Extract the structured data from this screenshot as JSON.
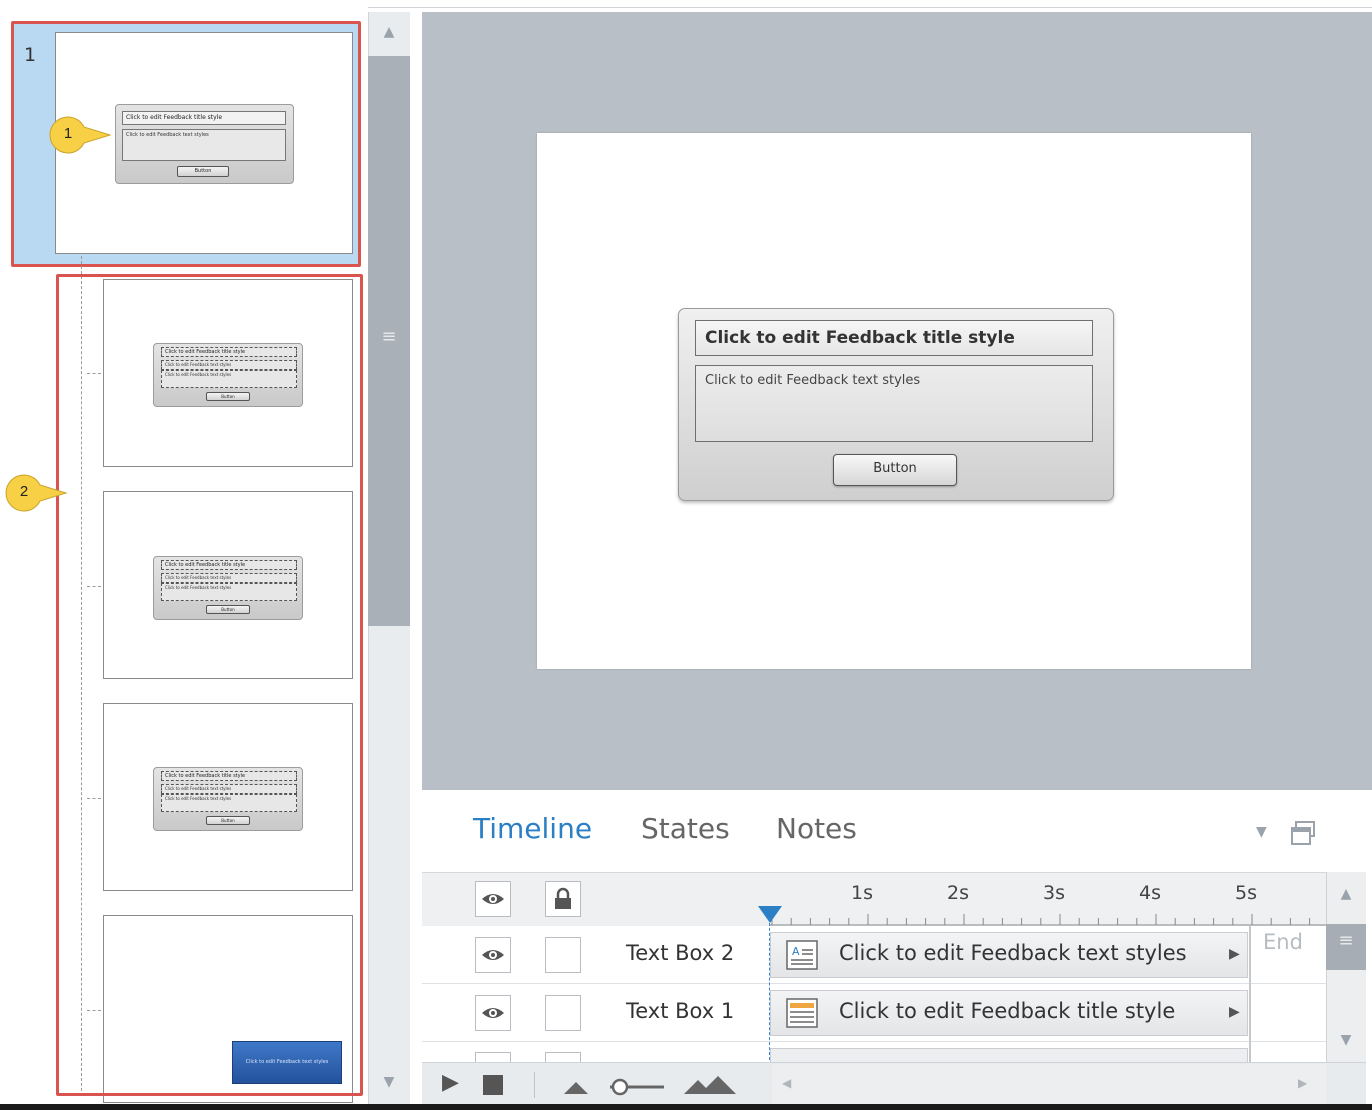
{
  "filmstrip": {
    "selected_slide_number": "1",
    "thumbnails": [
      {
        "title": "Click to edit Feedback title style",
        "text": "Click to edit Feedback text styles",
        "button": "Button"
      },
      {
        "line1": "Click to edit Feedback title style",
        "line2": "Click to edit Feedback text styles",
        "line3": "Click to edit Feedback text styles",
        "button": "Button"
      },
      {
        "line1": "Click to edit Feedback title style",
        "line2": "Click to edit Feedback text styles",
        "line3": "Click to edit Feedback text styles",
        "button": "Button"
      },
      {
        "line1": "Click to edit Feedback title style",
        "line2": "Click to edit Feedback text styles",
        "line3": "Click to edit Feedback text styles",
        "button": "Button"
      },
      {
        "button": "Click to edit Feedback text styles"
      }
    ],
    "callouts": [
      "1",
      "2"
    ]
  },
  "stage": {
    "feedback_title": "Click to edit Feedback title style",
    "feedback_text": "Click to edit Feedback text styles",
    "button_label": "Button"
  },
  "timeline": {
    "tabs": [
      {
        "label": "Timeline",
        "active": true
      },
      {
        "label": "States",
        "active": false
      },
      {
        "label": "Notes",
        "active": false
      }
    ],
    "ticks": [
      "1s",
      "2s",
      "3s",
      "4s",
      "5s"
    ],
    "end_label": "End",
    "rows": [
      {
        "name": "Text Box 2",
        "bar_text": "Click to edit Feedback text styles"
      },
      {
        "name": "Text Box 1",
        "bar_text": "Click to edit Feedback title style"
      }
    ]
  },
  "colors": {
    "accent": "#2b7fc4",
    "callout": "#f7d046",
    "highlight_border": "#d9534f",
    "stage_bg": "#b8bfc6"
  }
}
